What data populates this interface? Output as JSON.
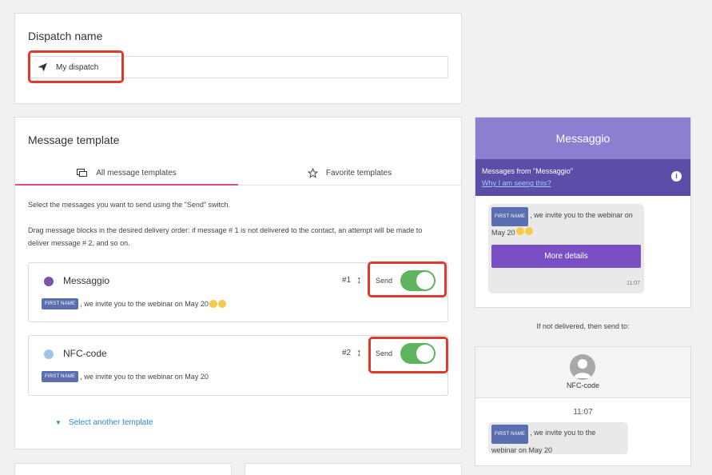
{
  "dispatch": {
    "title": "Dispatch name",
    "name_value": "My dispatch"
  },
  "template": {
    "title": "Message template",
    "tabs": [
      {
        "label": "All message templates",
        "icon": "chat-bubbles-icon",
        "active": true
      },
      {
        "label": "Favorite templates",
        "icon": "star-icon",
        "active": false
      }
    ],
    "desc1": "Select the messages you want to send using the \"Send\" switch.",
    "desc2": "Drag message blocks in the desired delivery order: if message # 1 is not delivered to the contact, an attempt will be made to deliver message # 2, and so on.",
    "messages": [
      {
        "channel": "Messaggio",
        "order": "#1",
        "send_label": "Send",
        "send_on": true,
        "tag": "FIRST NAME",
        "text": ", we invite you to the webinar on May 20",
        "icon": "viber-icon",
        "icon_color": "#7d54a8",
        "has_emoji": true
      },
      {
        "channel": "NFC-code",
        "order": "#2",
        "send_label": "Send",
        "send_on": true,
        "tag": "FIRST NAME",
        "text": ", we invite you to the webinar on May 20",
        "icon": "nfc-icon",
        "icon_color": "#9fc4e6",
        "has_emoji": false
      }
    ],
    "select_another": "Select another template"
  },
  "preview": {
    "sender": "Messaggio",
    "from_text": "Messages from \"Messaggio\"",
    "why_link": "Why I am seeng this?",
    "bubble_tag": "FIRST NAME",
    "bubble_text1": ", we invite you to the webinar on May 20",
    "more_button": "More details",
    "time": "11:07"
  },
  "fallback_label": "If not delivered, then send to:",
  "nfc_preview": {
    "name": "NFC-code",
    "time": "11:07",
    "bubble_tag": "FIRST NAME",
    "bubble_text1": ", we invite you to the",
    "bubble_text2": "webinar on May 20"
  },
  "colors": {
    "accent_tab": "#e84a7f",
    "toggle_on": "#5fb55f",
    "preview_header": "#8b7fd1",
    "preview_sub": "#5b4ea6",
    "button": "#7b4fc4",
    "link": "#2d89d6",
    "highlight": "#e03a2f"
  }
}
